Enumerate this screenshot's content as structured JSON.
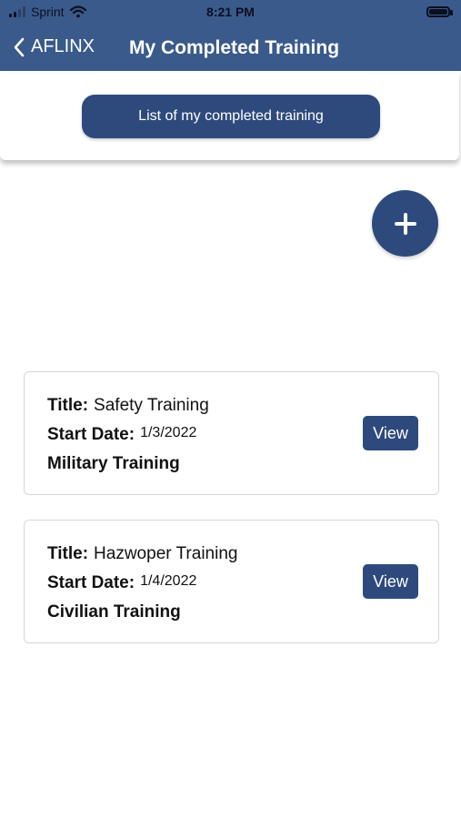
{
  "status_bar": {
    "carrier": "Sprint",
    "time": "8:21 PM",
    "battery_fill_fraction": 0.9
  },
  "header": {
    "back_label": "AFLINX",
    "title": "My Completed Training"
  },
  "list_button_label": "List of my completed training",
  "add_button": {
    "icon": "plus-icon"
  },
  "labels": {
    "title": "Title:",
    "start_date": "Start Date:"
  },
  "trainings": [
    {
      "title": "Safety Training",
      "start_date": "1/3/2022",
      "type": "Military Training",
      "view_label": "View"
    },
    {
      "title": "Hazwoper Training",
      "start_date": "1/4/2022",
      "type": "Civilian Training",
      "view_label": "View"
    }
  ],
  "colors": {
    "header_bg": "#3a5a8c",
    "button_bg": "#2e4a7d",
    "card_border": "#d6d6d6"
  }
}
